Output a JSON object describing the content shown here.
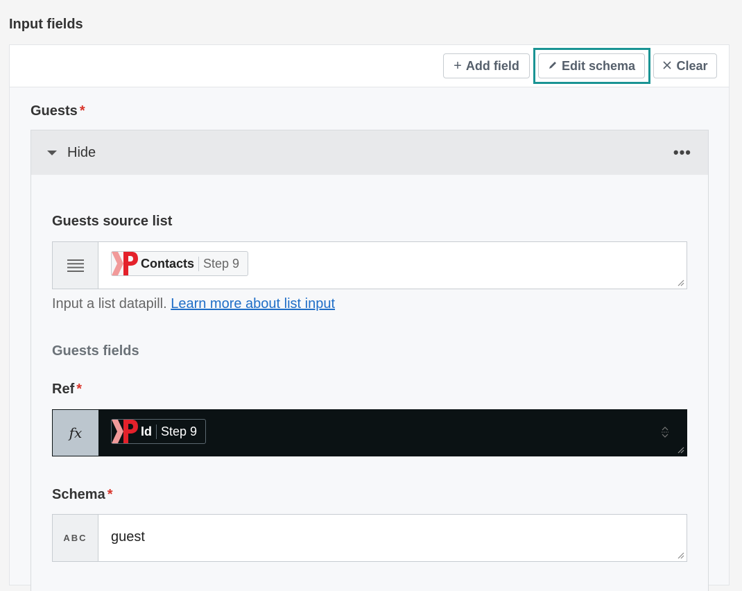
{
  "section_title": "Input fields",
  "toolbar": {
    "add_field": "Add field",
    "edit_schema": "Edit schema",
    "clear": "Clear"
  },
  "guests": {
    "label": "Guests",
    "required_mark": "*",
    "collapse_label": "Hide",
    "more_icon": "more-horizontal-icon",
    "source_list": {
      "label": "Guests source list",
      "pill_name": "Contacts",
      "pill_step": "Step 9",
      "help_text": "Input a list datapill.",
      "help_link": "Learn more about list input"
    },
    "fields_heading": "Guests fields",
    "ref": {
      "label": "Ref",
      "required_mark": "*",
      "mode_icon": "fx",
      "pill_name": "Id",
      "pill_step": "Step 9"
    },
    "schema": {
      "label": "Schema",
      "required_mark": "*",
      "mode_icon": "ABC",
      "value": "guest"
    }
  },
  "colors": {
    "highlight": "#1a9494",
    "required": "#d9352b",
    "link": "#1f6ec7",
    "formula_bg": "#0b1214",
    "logo_red": "#e4212b"
  }
}
